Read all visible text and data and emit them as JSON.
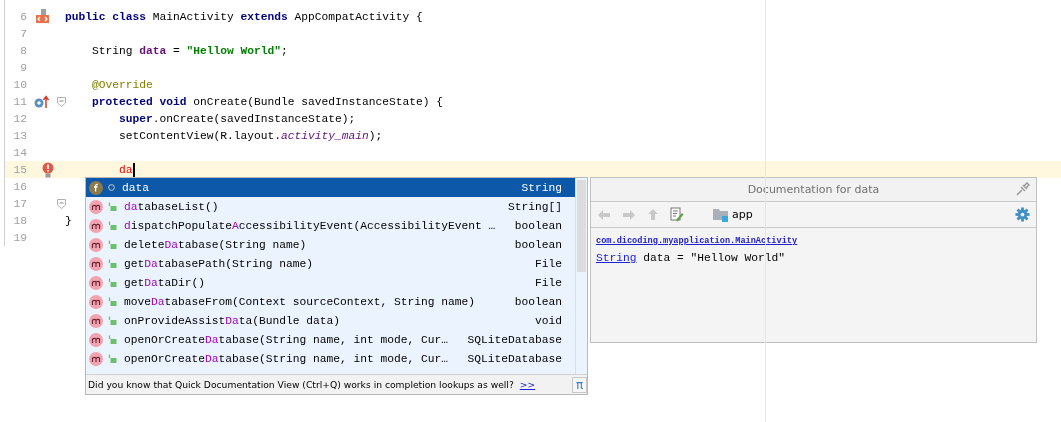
{
  "editor": {
    "lines": [
      {
        "number": "6",
        "kind": "layout",
        "fold": false,
        "current": false,
        "tokens": [
          {
            "kind": "keyword",
            "text": "public class"
          },
          {
            "kind": "plain",
            "text": " MainActivity "
          },
          {
            "kind": "keyword",
            "text": "extends"
          },
          {
            "kind": "plain",
            "text": " AppCompatActivity {"
          }
        ]
      },
      {
        "number": "7",
        "kind": "plain",
        "fold": false,
        "current": false
      },
      {
        "number": "8",
        "kind": "plain",
        "fold": false,
        "current": false,
        "tokens": [
          {
            "kind": "plain",
            "text": "    String "
          },
          {
            "kind": "field",
            "text": "data"
          },
          {
            "kind": "plain",
            "text": " = "
          },
          {
            "kind": "string",
            "text": "\"Hellow World\""
          },
          {
            "kind": "plain",
            "text": ";"
          }
        ]
      },
      {
        "number": "9",
        "kind": "plain",
        "fold": false,
        "current": false
      },
      {
        "number": "10",
        "kind": "plain",
        "fold": false,
        "current": false,
        "tokens": [
          {
            "kind": "annotation",
            "text": "    @Override"
          }
        ]
      },
      {
        "number": "11",
        "kind": "override",
        "fold": true,
        "current": false,
        "tokens": [
          {
            "kind": "keyword",
            "text": "    protected void"
          },
          {
            "kind": "plain",
            "text": " onCreate(Bundle savedInstanceState) {"
          }
        ]
      },
      {
        "number": "12",
        "kind": "plain",
        "fold": false,
        "current": false,
        "tokens": [
          {
            "kind": "keyword",
            "text": "        super"
          },
          {
            "kind": "plain",
            "text": ".onCreate(savedInstanceState);"
          }
        ]
      },
      {
        "number": "13",
        "kind": "plain",
        "fold": false,
        "current": false,
        "tokens": [
          {
            "kind": "plain",
            "text": "        setContentView(R.layout."
          },
          {
            "kind": "static",
            "text": "activity_main"
          },
          {
            "kind": "plain",
            "text": ");"
          }
        ]
      },
      {
        "number": "14",
        "kind": "plain",
        "fold": false,
        "current": false
      },
      {
        "number": "15",
        "kind": "bulb",
        "fold": false,
        "current": true,
        "tokens": [
          {
            "kind": "error",
            "text": "        da"
          }
        ]
      },
      {
        "number": "16",
        "kind": "plain",
        "fold": false,
        "current": false
      },
      {
        "number": "17",
        "kind": "plain",
        "fold": true,
        "current": false
      },
      {
        "number": "18",
        "kind": "plain",
        "fold": false,
        "current": false,
        "tokens": [
          {
            "kind": "plain",
            "text": "}"
          }
        ]
      },
      {
        "number": "19",
        "kind": "plain",
        "fold": false,
        "current": false
      }
    ]
  },
  "completion": {
    "items": [
      {
        "kind": "field",
        "selected": true,
        "parts": [
          {
            "text": "data",
            "match": false
          }
        ],
        "type": "String"
      },
      {
        "kind": "method",
        "selected": false,
        "parts": [
          {
            "text": "da",
            "match": true
          },
          {
            "text": "tabaseList()",
            "match": false
          }
        ],
        "type": "String[]"
      },
      {
        "kind": "method",
        "selected": false,
        "parts": [
          {
            "text": "d",
            "match": true
          },
          {
            "text": "ispatchPopulate",
            "match": false
          },
          {
            "text": "A",
            "match": true
          },
          {
            "text": "ccessibilityEvent(AccessibilityEvent …",
            "match": false
          }
        ],
        "type": "boolean"
      },
      {
        "kind": "method",
        "selected": false,
        "parts": [
          {
            "text": "delete",
            "match": false
          },
          {
            "text": "Da",
            "match": true
          },
          {
            "text": "tabase(String name)",
            "match": false
          }
        ],
        "type": "boolean"
      },
      {
        "kind": "method",
        "selected": false,
        "parts": [
          {
            "text": "get",
            "match": false
          },
          {
            "text": "Da",
            "match": true
          },
          {
            "text": "tabasePath(String name)",
            "match": false
          }
        ],
        "type": "File"
      },
      {
        "kind": "method",
        "selected": false,
        "parts": [
          {
            "text": "get",
            "match": false
          },
          {
            "text": "Da",
            "match": true
          },
          {
            "text": "taDir()",
            "match": false
          }
        ],
        "type": "File"
      },
      {
        "kind": "method",
        "selected": false,
        "parts": [
          {
            "text": "move",
            "match": false
          },
          {
            "text": "Da",
            "match": true
          },
          {
            "text": "tabaseFrom(Context sourceContext, String name)",
            "match": false
          }
        ],
        "type": "boolean"
      },
      {
        "kind": "method",
        "selected": false,
        "parts": [
          {
            "text": "onProvideAssist",
            "match": false
          },
          {
            "text": "Da",
            "match": true
          },
          {
            "text": "ta(Bundle data)",
            "match": false
          }
        ],
        "type": "void"
      },
      {
        "kind": "method",
        "selected": false,
        "parts": [
          {
            "text": "openOrCreate",
            "match": false
          },
          {
            "text": "Da",
            "match": true
          },
          {
            "text": "tabase(String name, int mode, Cur…",
            "match": false
          }
        ],
        "type": "SQLiteDatabase"
      },
      {
        "kind": "method",
        "selected": false,
        "parts": [
          {
            "text": "openOrCreate",
            "match": false
          },
          {
            "text": "Da",
            "match": true
          },
          {
            "text": "tabase(String name, int mode, Cur…",
            "match": false
          }
        ],
        "type": "SQLiteDatabase"
      }
    ],
    "hint": "Did you know that Quick Documentation View (Ctrl+Q) works in completion lookups as well?",
    "hint_link": ">>",
    "hint_button": "π"
  },
  "documentation": {
    "title": "Documentation for data",
    "module": "app",
    "class_link": "com.dicoding.myapplication.MainActivity",
    "type_link": "String",
    "declaration": " data = \"Hellow World\""
  }
}
